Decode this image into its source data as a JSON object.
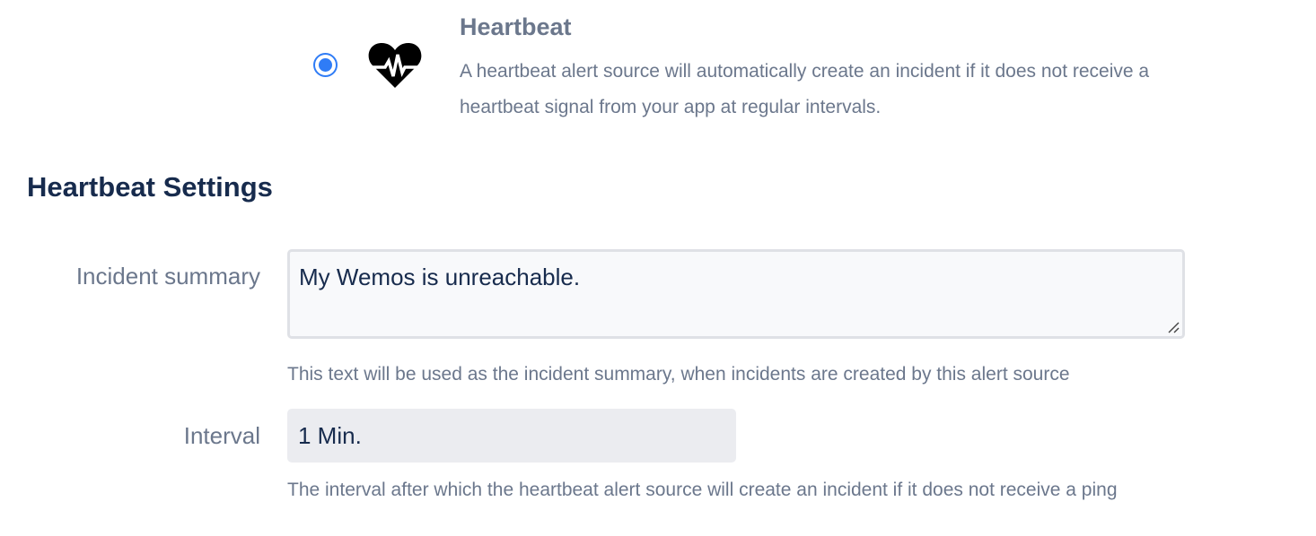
{
  "alert_source": {
    "selected": true,
    "icon": "heartbeat-icon",
    "title": "Heartbeat",
    "description": "A heartbeat alert source will automatically create an incident if it does not receive a heartbeat signal from your app at regular intervals."
  },
  "settings": {
    "heading": "Heartbeat Settings",
    "incident_summary": {
      "label": "Incident summary",
      "value": "My Wemos is unreachable.",
      "help": "This text will be used as the incident summary, when incidents are created by this alert source"
    },
    "interval": {
      "label": "Interval",
      "value": "1 Min.",
      "help": "The interval after which the heartbeat alert source will create an incident if it does not receive a ping"
    }
  },
  "colors": {
    "accent": "#2f7cf6",
    "heading": "#172b4d",
    "muted_text": "#6b778c",
    "input_border": "#dfe1e6",
    "select_bg": "#ebecf0"
  }
}
